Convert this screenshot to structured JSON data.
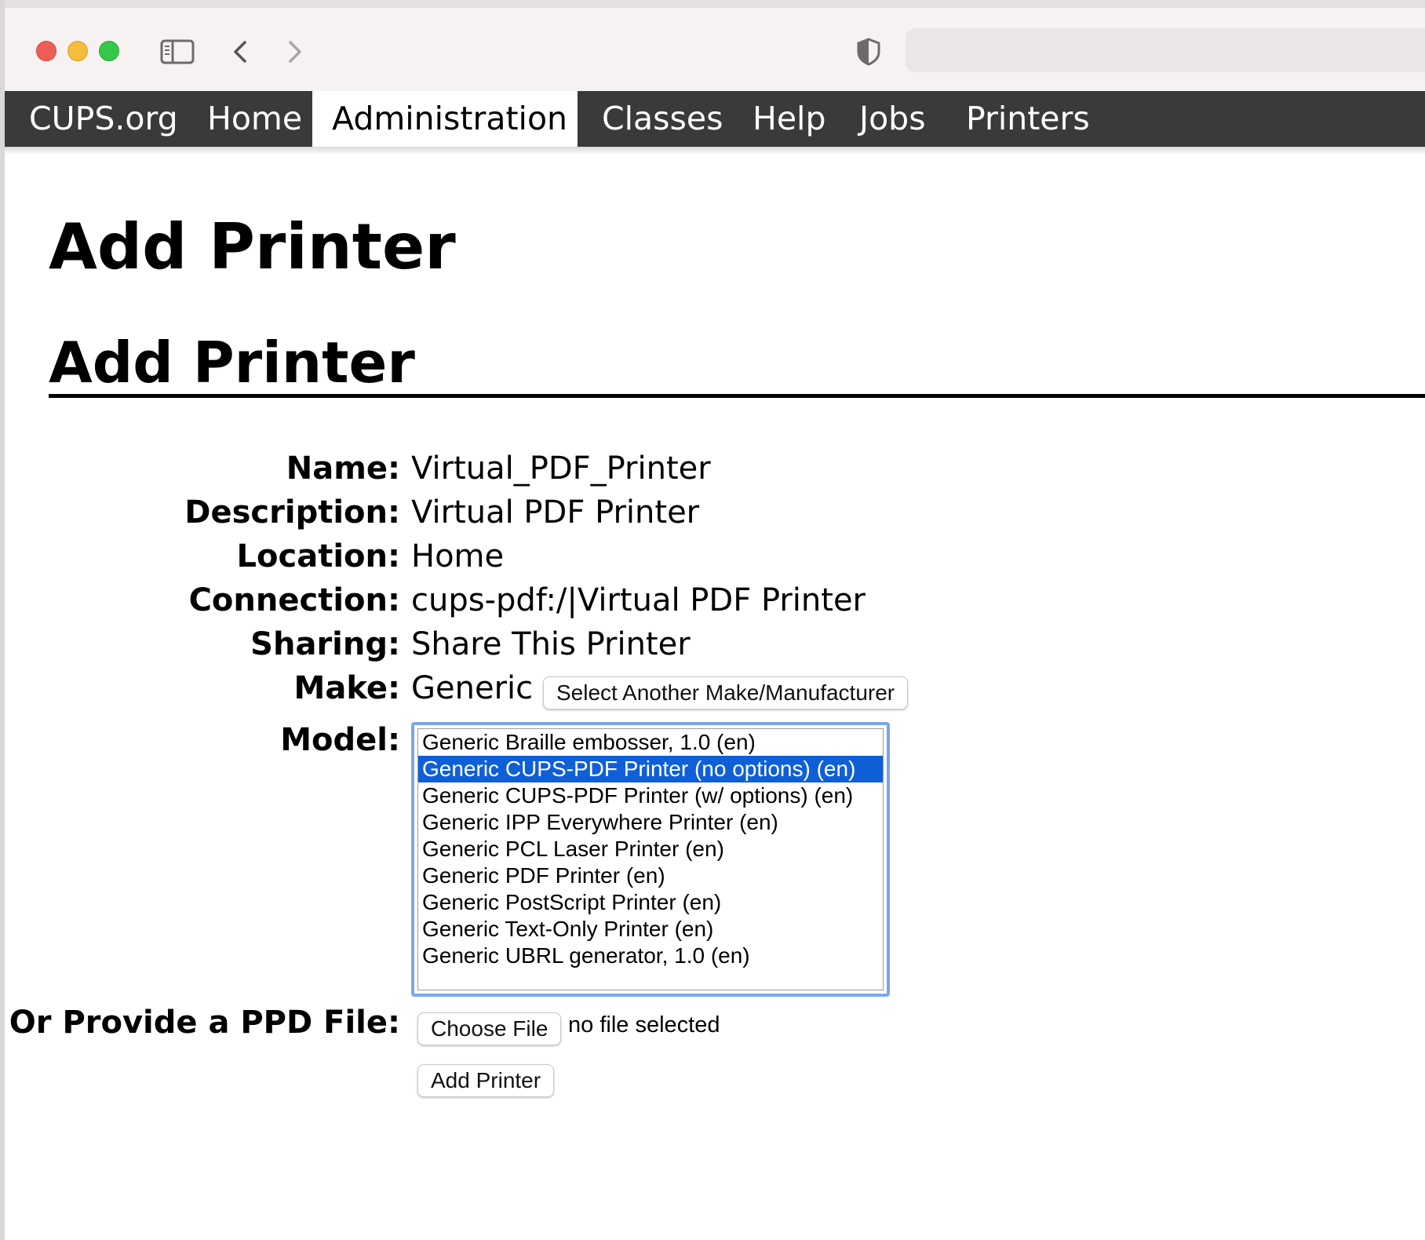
{
  "nav": {
    "items": [
      {
        "label": "CUPS.org"
      },
      {
        "label": "Home"
      },
      {
        "label": "Administration"
      },
      {
        "label": "Classes"
      },
      {
        "label": "Help"
      },
      {
        "label": "Jobs"
      },
      {
        "label": "Printers"
      }
    ],
    "active": "Administration"
  },
  "page": {
    "title": "Add Printer",
    "section_title": "Add Printer"
  },
  "form": {
    "name_label": "Name:",
    "name_value": "Virtual_PDF_Printer",
    "description_label": "Description:",
    "description_value": "Virtual PDF Printer",
    "location_label": "Location:",
    "location_value": "Home",
    "connection_label": "Connection:",
    "connection_value": "cups-pdf:/|Virtual PDF Printer",
    "sharing_label": "Sharing:",
    "sharing_value": "Share This Printer",
    "make_label": "Make:",
    "make_value": "Generic",
    "select_make_button": "Select Another Make/Manufacturer",
    "model_label": "Model:",
    "models": [
      "Generic Braille embosser, 1.0 (en)",
      "Generic CUPS-PDF Printer (no options) (en)",
      "Generic CUPS-PDF Printer (w/ options) (en)",
      "Generic IPP Everywhere Printer (en)",
      "Generic PCL Laser Printer (en)",
      "Generic PDF Printer (en)",
      "Generic PostScript Printer (en)",
      "Generic Text-Only Printer (en)",
      "Generic UBRL generator, 1.0 (en)"
    ],
    "selected_model": "Generic CUPS-PDF Printer (no options) (en)",
    "ppd_label": "Or Provide a PPD File:",
    "choose_file_button": "Choose File",
    "no_file_text": "no file selected",
    "submit_button": "Add Printer"
  },
  "colors": {
    "nav_bg": "#3a3a3a",
    "selected_option_bg": "#0f5fd7",
    "listbox_focus": "#7aa7ea"
  }
}
